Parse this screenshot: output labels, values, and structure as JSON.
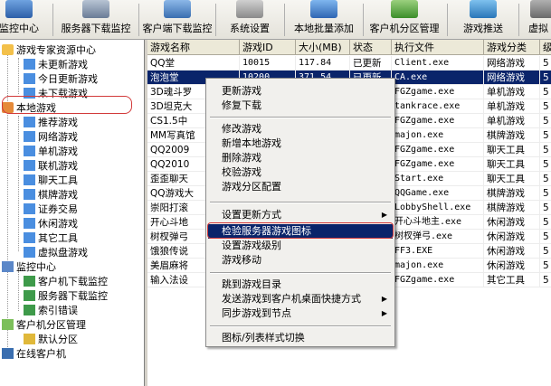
{
  "toolbar": {
    "buttons": [
      {
        "label": "监控中心",
        "icon": "monitor-icon"
      },
      {
        "label": "服务器下载监控",
        "icon": "server-download-icon"
      },
      {
        "label": "客户端下载监控",
        "icon": "client-download-icon"
      },
      {
        "label": "系统设置",
        "icon": "settings-icon"
      },
      {
        "label": "本地批量添加",
        "icon": "batch-add-icon"
      },
      {
        "label": "客户机分区管理",
        "icon": "partition-icon"
      },
      {
        "label": "游戏推送",
        "icon": "push-icon"
      },
      {
        "label": "虚拟",
        "icon": "virtual-icon"
      }
    ]
  },
  "tree": {
    "items": [
      {
        "label": "游戏专家资源中心",
        "level": 0
      },
      {
        "label": "未更新游戏",
        "level": 1
      },
      {
        "label": "今日更新游戏",
        "level": 1
      },
      {
        "label": "未下载游戏",
        "level": 1
      },
      {
        "label": "本地游戏",
        "level": 0
      },
      {
        "label": "推荐游戏",
        "level": 1
      },
      {
        "label": "网络游戏",
        "level": 1
      },
      {
        "label": "单机游戏",
        "level": 1
      },
      {
        "label": "联机游戏",
        "level": 1
      },
      {
        "label": "聊天工具",
        "level": 1
      },
      {
        "label": "棋牌游戏",
        "level": 1
      },
      {
        "label": "证券交易",
        "level": 1
      },
      {
        "label": "休闲游戏",
        "level": 1
      },
      {
        "label": "其它工具",
        "level": 1
      },
      {
        "label": "虚拟盘游戏",
        "level": 1
      },
      {
        "label": "监控中心",
        "level": 0
      },
      {
        "label": "客户机下载监控",
        "level": 1
      },
      {
        "label": "服务器下载监控",
        "level": 1
      },
      {
        "label": "索引错误",
        "level": 1
      },
      {
        "label": "客户机分区管理",
        "level": 0
      },
      {
        "label": "默认分区",
        "level": 1
      },
      {
        "label": "在线客户机",
        "level": 0
      }
    ]
  },
  "grid": {
    "columns": [
      "游戏名称",
      "游戏ID",
      "大小(MB)",
      "状态",
      "执行文件",
      "游戏分类",
      "级"
    ],
    "rows": [
      [
        "QQ堂",
        "10015",
        "117.84",
        "已更新",
        "Client.exe",
        "网络游戏",
        "5"
      ],
      [
        "泡泡堂",
        "10200",
        "371.54",
        "已更新",
        "CA.exe",
        "网络游戏",
        "5"
      ],
      [
        "3D魂斗罗",
        "",
        "",
        "",
        "FGZgame.exe",
        "单机游戏",
        "5"
      ],
      [
        "3D坦克大",
        "",
        "",
        "",
        "tankrace.exe",
        "单机游戏",
        "5"
      ],
      [
        "CS1.5中",
        "",
        "",
        "",
        "FGZgame.exe",
        "单机游戏",
        "5"
      ],
      [
        "MM写真馆",
        "",
        "",
        "",
        "majon.exe",
        "棋牌游戏",
        "5"
      ],
      [
        "QQ2009",
        "",
        "",
        "",
        "FGZgame.exe",
        "聊天工具",
        "5"
      ],
      [
        "QQ2010",
        "",
        "",
        "",
        "FGZgame.exe",
        "聊天工具",
        "5"
      ],
      [
        "歪歪聊天",
        "",
        "",
        "",
        "Start.exe",
        "聊天工具",
        "5"
      ],
      [
        "QQ游戏大",
        "",
        "",
        "",
        "QQGame.exe",
        "棋牌游戏",
        "5"
      ],
      [
        "崇阳打滚",
        "",
        "",
        "",
        "LobbyShell.exe",
        "棋牌游戏",
        "5"
      ],
      [
        "开心斗地",
        "",
        "",
        "",
        "开心斗地主.exe",
        "休闲游戏",
        "5"
      ],
      [
        "树杈弹弓",
        "",
        "",
        "",
        "树杈弹弓.exe",
        "休闲游戏",
        "5"
      ],
      [
        "饿狼传说",
        "",
        "",
        "",
        "FF3.EXE",
        "休闲游戏",
        "5"
      ],
      [
        "美眉麻将",
        "",
        "",
        "",
        "majon.exe",
        "休闲游戏",
        "5"
      ],
      [
        "输入法设",
        "",
        "",
        "",
        "FGZgame.exe",
        "其它工具",
        "5"
      ]
    ]
  },
  "menu": {
    "items": [
      {
        "label": "更新游戏",
        "type": "item"
      },
      {
        "label": "修复下载",
        "type": "item"
      },
      {
        "type": "sep"
      },
      {
        "label": "修改游戏",
        "type": "item"
      },
      {
        "label": "新增本地游戏",
        "type": "item"
      },
      {
        "label": "删除游戏",
        "type": "item"
      },
      {
        "label": "校验游戏",
        "type": "item"
      },
      {
        "label": "游戏分区配置",
        "type": "item"
      },
      {
        "type": "sep"
      },
      {
        "label": "设置更新方式",
        "type": "sub"
      },
      {
        "label": "检验服务器游戏图标",
        "type": "hot"
      },
      {
        "label": "设置游戏级别",
        "type": "item"
      },
      {
        "label": "游戏移动",
        "type": "item"
      },
      {
        "type": "sep"
      },
      {
        "label": "跳到游戏目录",
        "type": "item"
      },
      {
        "label": "发送游戏到客户机桌面快捷方式",
        "type": "sub"
      },
      {
        "label": "同步游戏到节点",
        "type": "sub"
      },
      {
        "type": "sep"
      },
      {
        "label": "图标/列表样式切换",
        "type": "item"
      }
    ]
  },
  "colors": {
    "selection": "#0a246a",
    "highlight_ring": "#d23a3a"
  }
}
